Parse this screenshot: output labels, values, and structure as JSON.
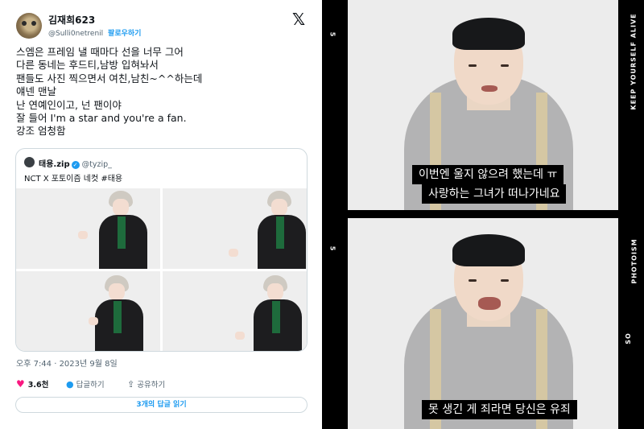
{
  "tweet": {
    "author_name": "김재희623",
    "handle": "@Sulli0netrenil",
    "follow_label": "팔로우하기",
    "x_logo": "𝕏",
    "lines": [
      "스엠은 프레임 낼 때마다 선을 너무 그어",
      "다른 동네는 후드티,남방 입혀놔서",
      "팬들도 사진 찍으면서 여친,남친~^^하는데",
      "얘넨 맨날",
      "난 연예인이고, 넌 팬이야",
      "잘 들어 I'm a star and you're a fan.",
      "강조 엄청함"
    ],
    "quote": {
      "name": "태용.zip",
      "verified": "✓",
      "handle": "@tyzip_",
      "text": "NCT X 포토이즘 네컷 #태용"
    },
    "timestamp": "오후 7:44 · 2023년 9월 8일",
    "actions": {
      "heart_icon": "♥",
      "likes": "3.6천",
      "reply_icon": "●",
      "reply_label": "답글하기",
      "share_icon": "⇪",
      "share_label": "공유하기"
    },
    "read_replies": "3개의 답글 읽기"
  },
  "film": {
    "frame_numbers": [
      "5",
      "5"
    ],
    "side_texts": [
      "KEEP YOURSELF ALIVE",
      "PHOTOISM",
      "SO"
    ],
    "captions": {
      "frame1_line1": "이번엔 울지 않으려 했는데 ㅠ",
      "frame1_line2": "사랑하는 그녀가 떠나가네요",
      "frame2_line1": "못 생긴 게 죄라면 당신은 유죄"
    }
  },
  "colors": {
    "accent": "#1d9bf0",
    "heart": "#f91880",
    "film_bg": "#000000"
  }
}
